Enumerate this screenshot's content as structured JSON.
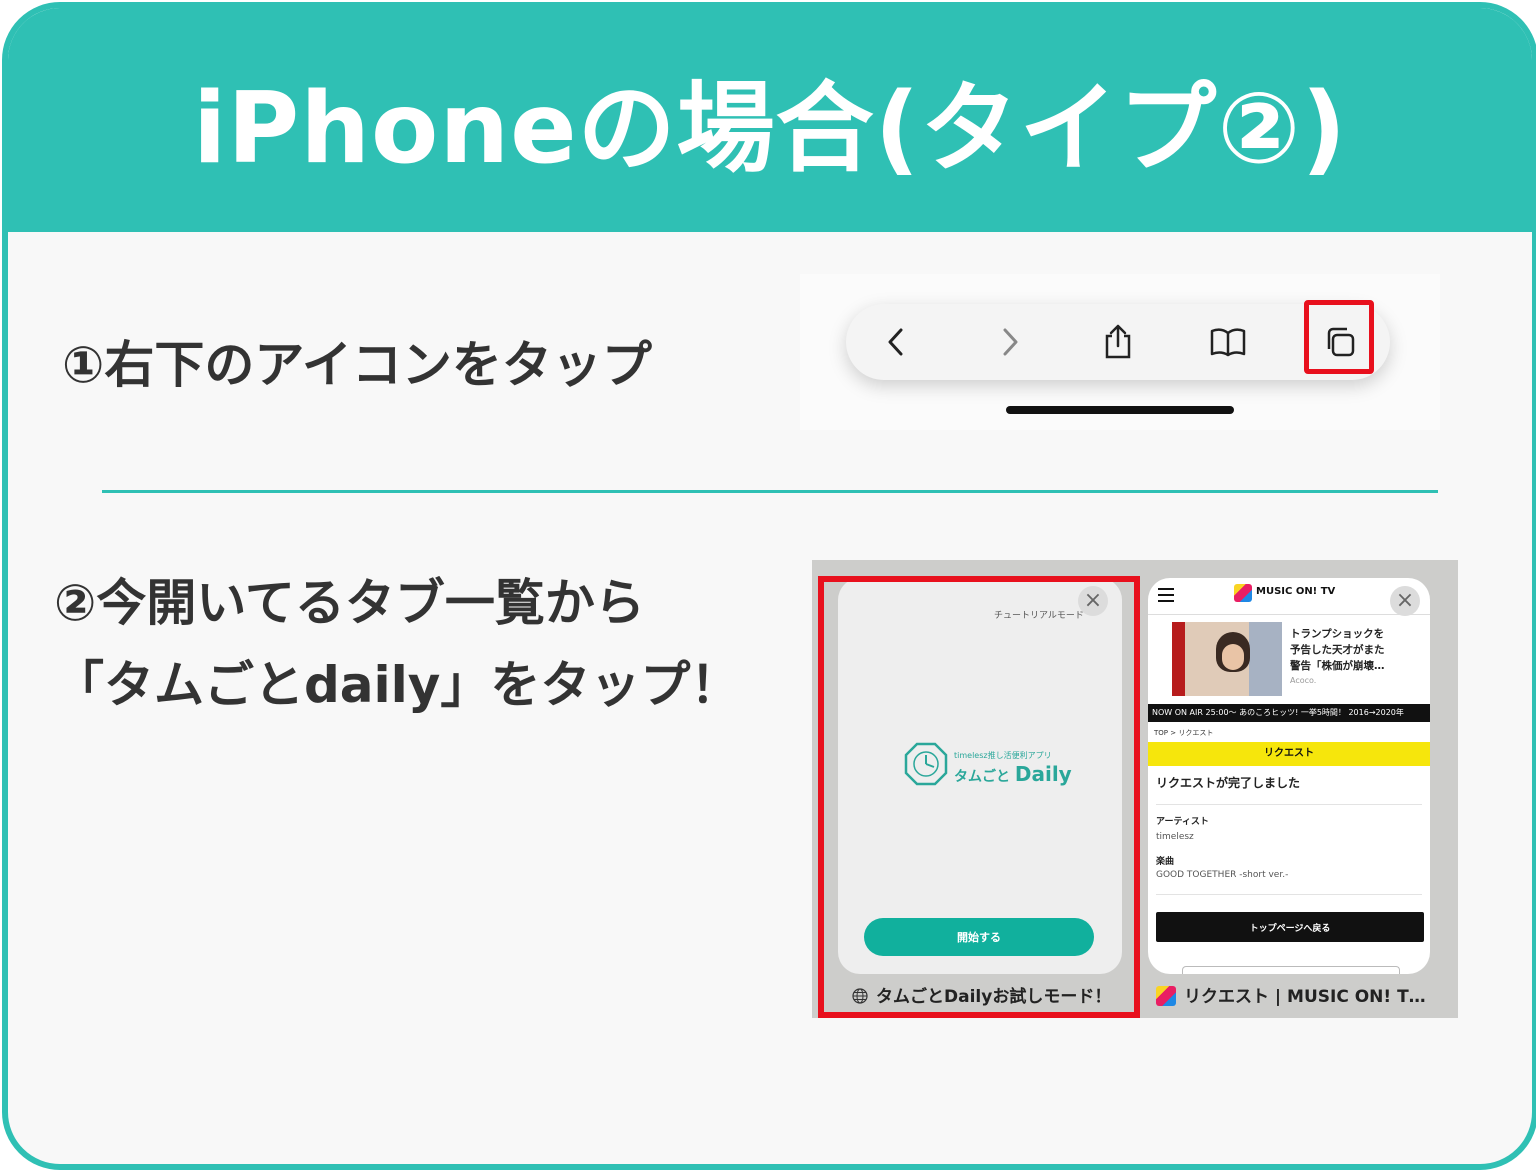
{
  "header": {
    "title": "iPhoneの場合(タイプ②)"
  },
  "steps": {
    "step1": "①右下のアイコンをタップ",
    "step2_line1": "②今開いてるタブ一覧から",
    "step2_line2": "「タムごとdaily」をタップ！"
  },
  "toolbar": {
    "buttons": [
      "back-icon",
      "forward-icon",
      "share-icon",
      "bookmarks-icon",
      "tabs-icon"
    ],
    "highlight_color": "#e8101d"
  },
  "tabs": {
    "tab1": {
      "tutorial_label": "チュートリアルモード",
      "app_tagline": "timelesz推し活便利アプリ",
      "app_name_kana": "タムごと",
      "app_name_latin": "Daily",
      "start_button": "開始する",
      "caption": "タムごとDailyお試しモード！"
    },
    "tab2": {
      "site_name": "MUSIC ON! TV",
      "news_line1": "トランプショックを",
      "news_line2": "予告した天才がまた",
      "news_line3": "警告「株価が崩壊…",
      "news_source": "Acoco.",
      "onair": "NOW ON AIR 25:00〜 あのころヒッツ! 一挙5時間！ 2016→2020年",
      "breadcrumb": "TOP > リクエスト",
      "request_header": "リクエスト",
      "request_done": "リクエストが完了しました",
      "artist_label": "アーティスト",
      "artist_value": "timelesz",
      "song_label": "楽曲",
      "song_value": "GOOD TOGETHER -short ver.-",
      "back_button": "トップページへ戻る",
      "caption": "リクエスト | MUSIC ON! T…"
    }
  },
  "colors": {
    "accent": "#2fc0b4",
    "highlight": "#e8101d",
    "start_button": "#11b09d"
  }
}
